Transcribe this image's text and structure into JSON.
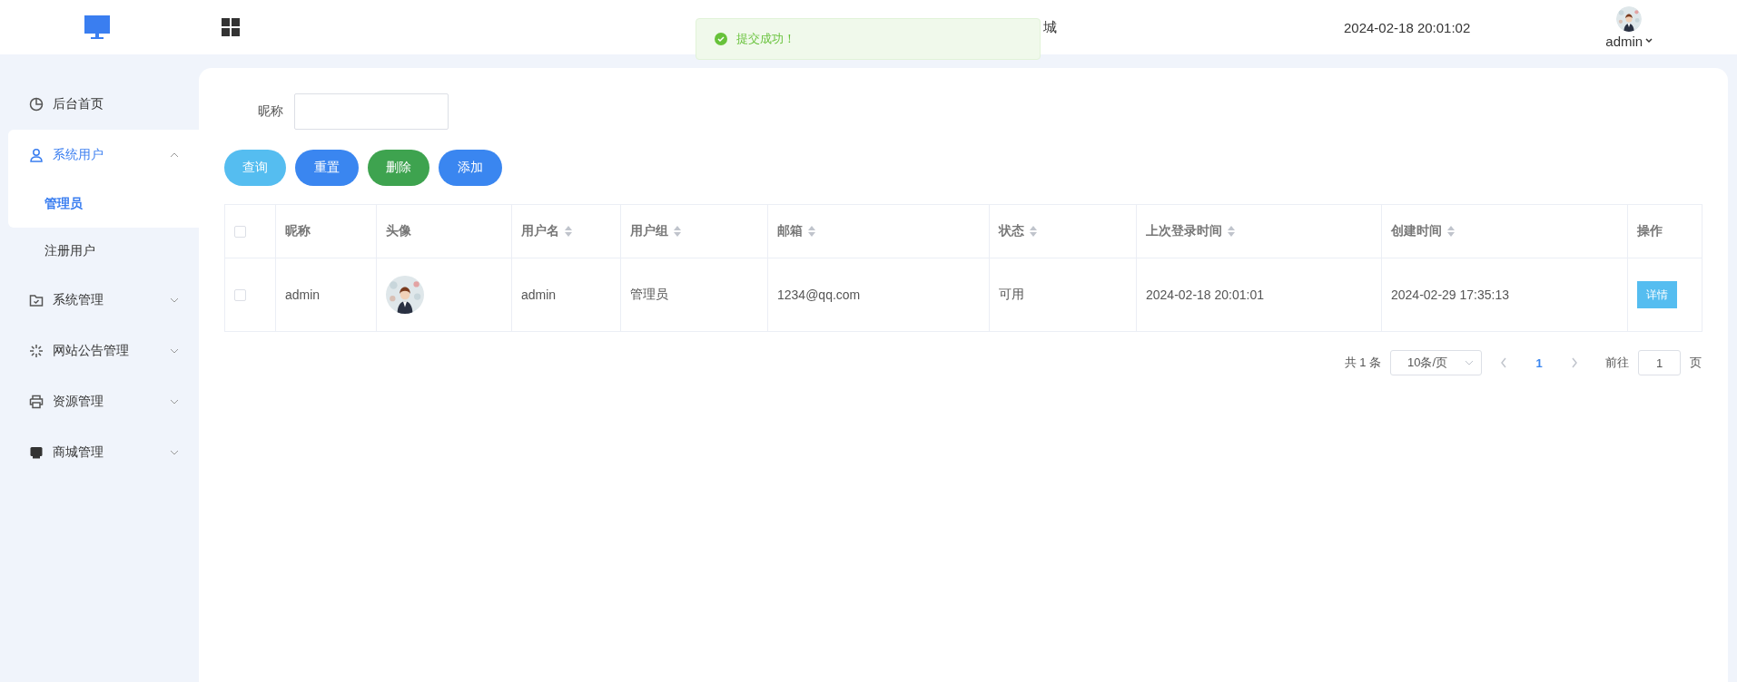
{
  "header": {
    "title": "城",
    "datetime": "2024-02-18 20:01:02",
    "user": "admin"
  },
  "toast": {
    "message": "提交成功！"
  },
  "sidebar": {
    "items": [
      {
        "label": "后台首页",
        "kind": "chart",
        "selected": false
      },
      {
        "label": "系统用户",
        "kind": "user",
        "selected": false,
        "expanded": true,
        "children": [
          {
            "label": "管理员",
            "selected": true
          },
          {
            "label": "注册用户",
            "selected": false
          }
        ]
      },
      {
        "label": "系统管理",
        "kind": "folder",
        "selected": false,
        "expanded": false
      },
      {
        "label": "网站公告管理",
        "kind": "spark",
        "selected": false,
        "expanded": false
      },
      {
        "label": "资源管理",
        "kind": "printer",
        "selected": false,
        "expanded": false
      },
      {
        "label": "商城管理",
        "kind": "shop",
        "selected": false,
        "expanded": false
      }
    ]
  },
  "search": {
    "label": "昵称"
  },
  "buttons": [
    {
      "label": "查询",
      "kind": "query"
    },
    {
      "label": "重置",
      "kind": "primary"
    },
    {
      "label": "删除",
      "kind": "danger"
    },
    {
      "label": "添加",
      "kind": "primary"
    }
  ],
  "table": {
    "all_checked": false,
    "columns": [
      {
        "label": "昵称",
        "sortable": false
      },
      {
        "label": "头像",
        "sortable": false
      },
      {
        "label": "用户名",
        "sortable": true
      },
      {
        "label": "用户组",
        "sortable": true
      },
      {
        "label": "邮箱",
        "sortable": true
      },
      {
        "label": "状态",
        "sortable": true
      },
      {
        "label": "上次登录时间",
        "sortable": true
      },
      {
        "label": "创建时间",
        "sortable": true
      },
      {
        "label": "操作",
        "sortable": false
      }
    ],
    "rows": [
      {
        "checked": false,
        "cells": [
          "admin",
          {
            "kind": "picture"
          },
          "admin",
          "管理员",
          "1234@qq.com",
          "可用",
          "2024-02-18 20:01:01",
          "2024-02-29 17:35:13",
          {
            "kind": "button",
            "label": "详情"
          }
        ]
      }
    ]
  },
  "pagination": {
    "total": "共 1 条",
    "page_size": "10条/页",
    "pages": [
      {
        "label": "1",
        "selected": true
      }
    ],
    "goto_label": "前往",
    "goto_value": "1",
    "goto_suffix": "页"
  }
}
